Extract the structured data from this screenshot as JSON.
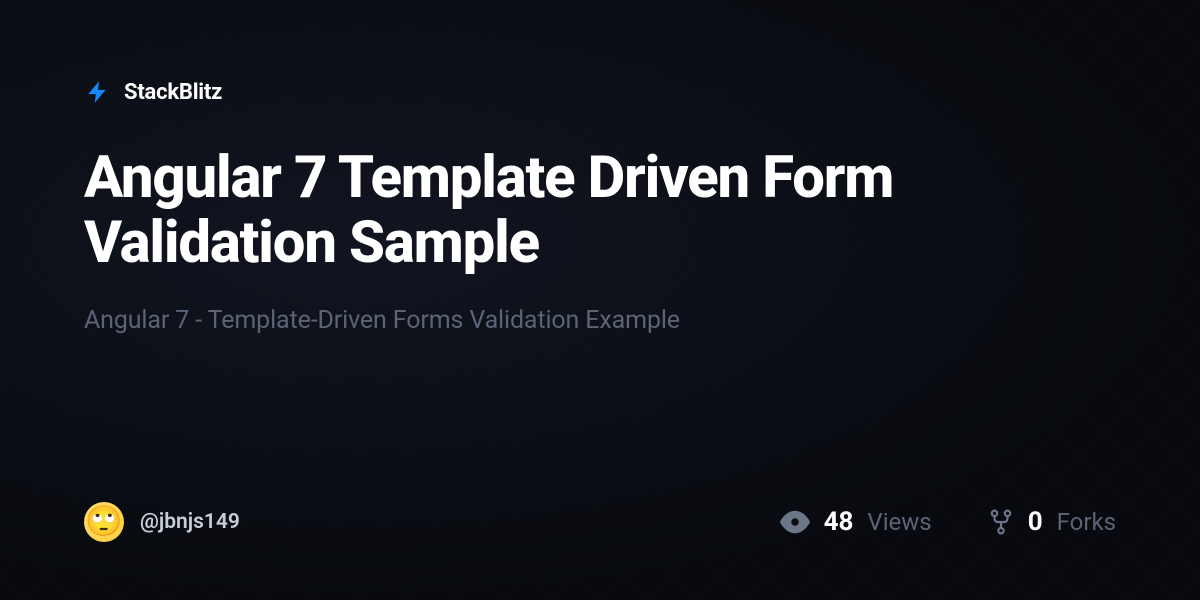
{
  "brand": {
    "name": "StackBlitz"
  },
  "project": {
    "title": "Angular 7 Template Driven Form Validation Sample",
    "subtitle": "Angular 7 - Template-Driven Forms Validation Example"
  },
  "author": {
    "avatar_emoji": "🙄",
    "username": "@jbnjs149"
  },
  "stats": {
    "views": {
      "value": "48",
      "label": "Views"
    },
    "forks": {
      "value": "0",
      "label": "Forks"
    }
  }
}
